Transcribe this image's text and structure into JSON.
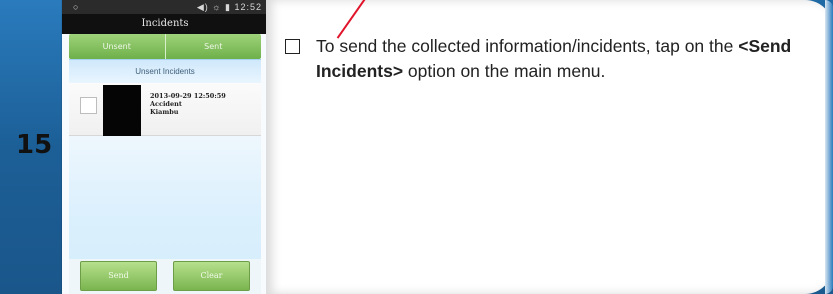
{
  "slide": {
    "number": "15",
    "instruction_prefix": "To send the collected information/incidents, tap on the ",
    "instruction_bold": "<Send Incidents>",
    "instruction_suffix": " option on the main menu."
  },
  "phone": {
    "status_bar": {
      "left_symbol": "○",
      "right": "◀) ☼ ▮ 12:52"
    },
    "title": "Incidents",
    "tabs": [
      {
        "label": "Unsent"
      },
      {
        "label": "Sent"
      }
    ],
    "section_header": "Unsent Incidents",
    "incidents": [
      {
        "timestamp": "2013-09-29 12:50:59",
        "type": "Accident",
        "location": "Kiambu"
      }
    ],
    "buttons": {
      "send": "Send",
      "clear": "Clear"
    }
  }
}
